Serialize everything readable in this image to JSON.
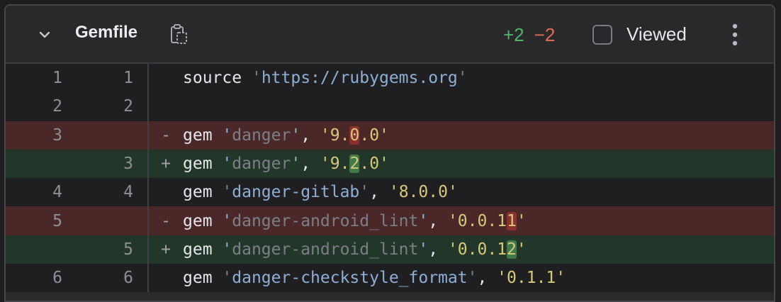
{
  "header": {
    "file_name": "Gemfile",
    "additions": "+2",
    "deletions": "−2",
    "viewed_label": "Viewed"
  },
  "diff": {
    "rows": [
      {
        "old": "1",
        "new": "1",
        "sign": "",
        "type": "normal",
        "kw": "source",
        "q1": "'",
        "s1": "https://rubygems.org",
        "q2": "'",
        "rest": ""
      },
      {
        "old": "2",
        "new": "2",
        "sign": "",
        "type": "normal",
        "kw": "",
        "q1": "",
        "s1": "",
        "q2": "",
        "rest": ""
      },
      {
        "old": "3",
        "new": "",
        "sign": "-",
        "type": "deleted",
        "kw": "gem",
        "name": "danger",
        "ver_pre": "9.",
        "ver_hl": "0",
        "ver_post": ".0"
      },
      {
        "old": "",
        "new": "3",
        "sign": "+",
        "type": "added",
        "kw": "gem",
        "name": "danger",
        "ver_pre": "9.",
        "ver_hl": "2",
        "ver_post": ".0"
      },
      {
        "old": "4",
        "new": "4",
        "sign": "",
        "type": "normal",
        "kw": "gem",
        "name": "danger-gitlab",
        "ver_pre": "8.0.0",
        "ver_hl": "",
        "ver_post": ""
      },
      {
        "old": "5",
        "new": "",
        "sign": "-",
        "type": "deleted",
        "kw": "gem",
        "name": "danger-android_lint",
        "ver_pre": "0.0.1",
        "ver_hl": "1",
        "ver_post": ""
      },
      {
        "old": "",
        "new": "5",
        "sign": "+",
        "type": "added",
        "kw": "gem",
        "name": "danger-android_lint",
        "ver_pre": "0.0.1",
        "ver_hl": "2",
        "ver_post": ""
      },
      {
        "old": "6",
        "new": "6",
        "sign": "",
        "type": "normal",
        "kw": "gem",
        "name": "danger-checkstyle_format",
        "ver_pre": "0.1.1",
        "ver_hl": "",
        "ver_post": ""
      }
    ]
  },
  "icons": {
    "collapse": "chevron-down-icon",
    "copy": "clipboard-copy-icon",
    "menu": "kebab-menu-icon"
  },
  "colors": {
    "added_bg": "#22362a",
    "deleted_bg": "#4a2828",
    "added_text": "#52b36a",
    "deleted_text": "#e36a55"
  }
}
